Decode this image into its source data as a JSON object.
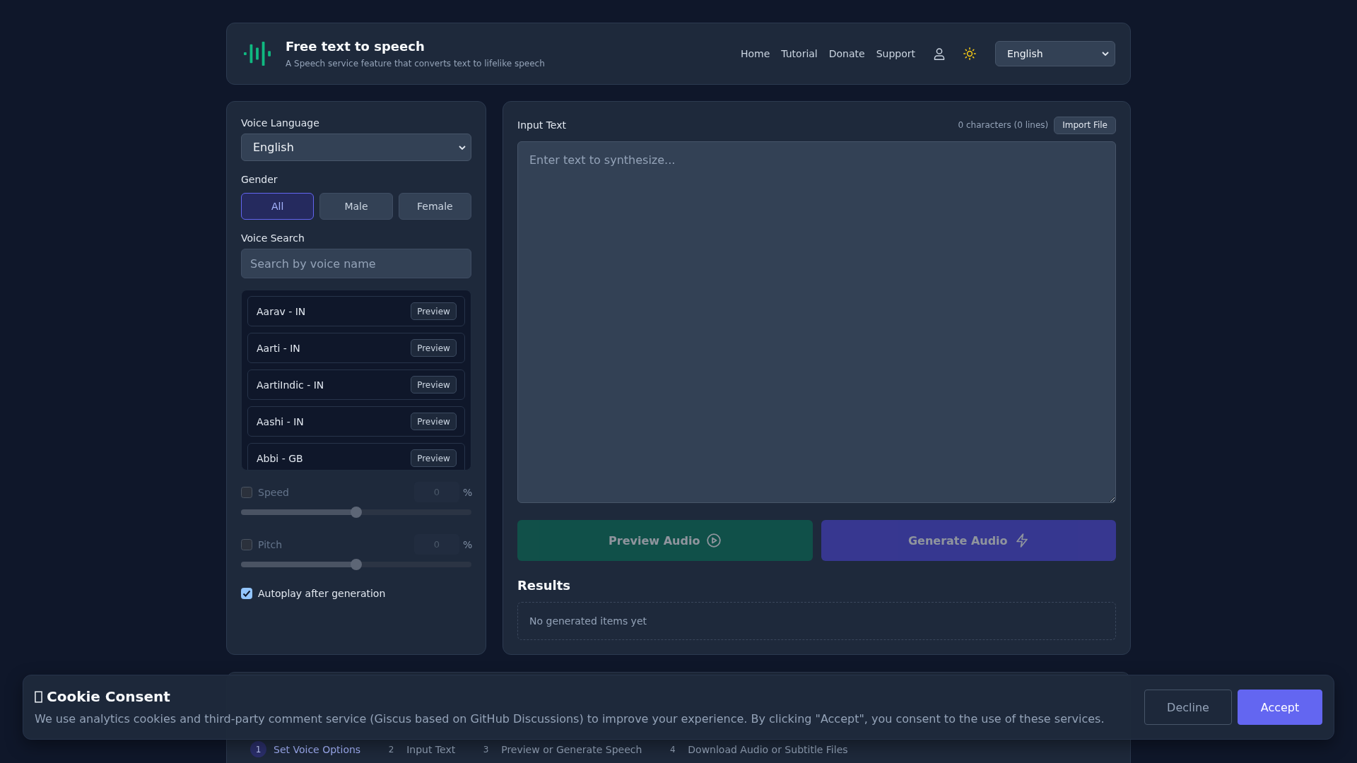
{
  "header": {
    "title": "Free text to speech",
    "subtitle": "A Speech service feature that converts text to lifelike speech",
    "nav": [
      {
        "label": "Home"
      },
      {
        "label": "Tutorial"
      },
      {
        "label": "Donate"
      },
      {
        "label": "Support"
      }
    ],
    "language_select": {
      "value": "English"
    }
  },
  "settings": {
    "voice_language": {
      "label": "Voice Language",
      "value": "English"
    },
    "gender": {
      "label": "Gender",
      "options": [
        {
          "label": "All",
          "selected": true
        },
        {
          "label": "Male",
          "selected": false
        },
        {
          "label": "Female",
          "selected": false
        }
      ]
    },
    "voice_search": {
      "label": "Voice Search",
      "placeholder": "Search by voice name"
    },
    "voices": [
      {
        "name": "Aarav - IN",
        "action": "Preview"
      },
      {
        "name": "Aarti - IN",
        "action": "Preview"
      },
      {
        "name": "AartiIndic - IN",
        "action": "Preview"
      },
      {
        "name": "Aashi - IN",
        "action": "Preview"
      },
      {
        "name": "Abbi - GB",
        "action": "Preview"
      }
    ],
    "adjustments": [
      {
        "label": "Speed",
        "checked": false,
        "value": "0",
        "unit": "%",
        "level": 0.5
      },
      {
        "label": "Pitch",
        "checked": false,
        "value": "0",
        "unit": "%",
        "level": 0.5
      }
    ],
    "autoplay": {
      "label": "Autoplay after generation",
      "checked": true
    }
  },
  "editor": {
    "label": "Input Text",
    "count": "0 characters (0 lines)",
    "import_button": "Import File",
    "placeholder": "Enter text to synthesize...",
    "actions": [
      {
        "label": "Preview Audio",
        "kind": "preview",
        "disabled": true
      },
      {
        "label": "Generate Audio",
        "kind": "generate",
        "disabled": true
      }
    ],
    "results": {
      "title": "Results",
      "empty_text": "No generated items yet"
    }
  },
  "steps": [
    {
      "number": "1",
      "label": "Set Voice Options",
      "selected": true
    },
    {
      "number": "2",
      "label": "Input Text",
      "selected": false
    },
    {
      "number": "3",
      "label": "Preview or Generate Speech",
      "selected": false
    },
    {
      "number": "4",
      "label": "Download Audio or Subtitle Files",
      "selected": false
    }
  ],
  "cookie_banner": {
    "title": "Cookie Consent",
    "text": "We use analytics cookies and third-party comment service (Giscus based on GitHub Discussions) to improve your experience. By clicking \"Accept\", you consent to the use of these services.",
    "buttons": [
      {
        "label": "Decline",
        "kind": "secondary"
      },
      {
        "label": "Accept",
        "kind": "primary"
      }
    ]
  }
}
